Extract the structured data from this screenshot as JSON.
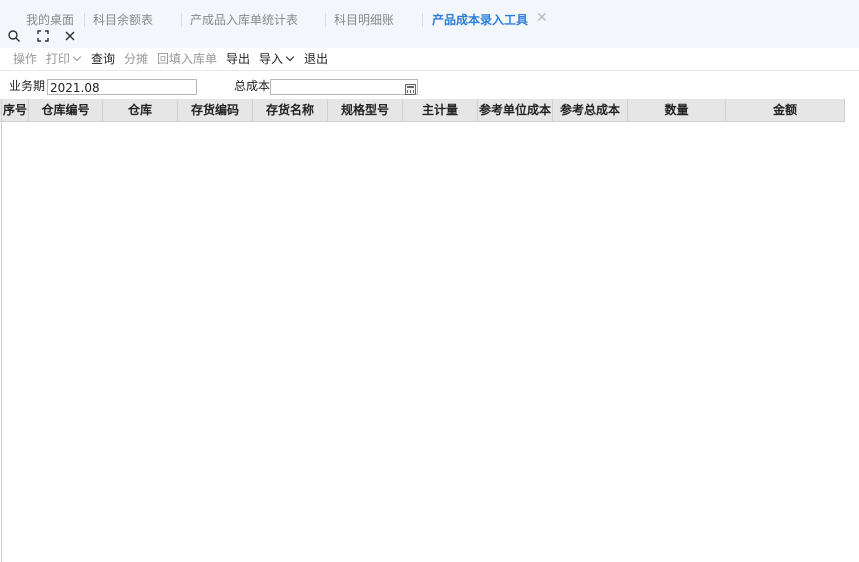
{
  "tabs": [
    {
      "label": "我的桌面"
    },
    {
      "label": "科目余额表"
    },
    {
      "label": "产成品入库单统计表"
    },
    {
      "label": "科目明细账"
    },
    {
      "label": "产品成本录入工具"
    }
  ],
  "toolbar": {
    "operate": "操作",
    "print": "打印",
    "query": "查询",
    "allocate": "分摊",
    "backfill": "回填入库单",
    "export": "导出",
    "import": "导入",
    "exit": "退出"
  },
  "form": {
    "period_label": "业务期",
    "period_value": "2021.08",
    "total_cost_label": "总成本",
    "total_cost_value": ""
  },
  "table": {
    "columns": [
      "序号",
      "仓库编号",
      "仓库",
      "存货编码",
      "存货名称",
      "规格型号",
      "主计量",
      "参考单位成本",
      "参考总成本",
      "数量",
      "金额"
    ],
    "rows": []
  },
  "colors": {
    "active_tab": "#2f7fd8",
    "disabled_text": "#999999",
    "header_bg": "#e6e6e6"
  }
}
